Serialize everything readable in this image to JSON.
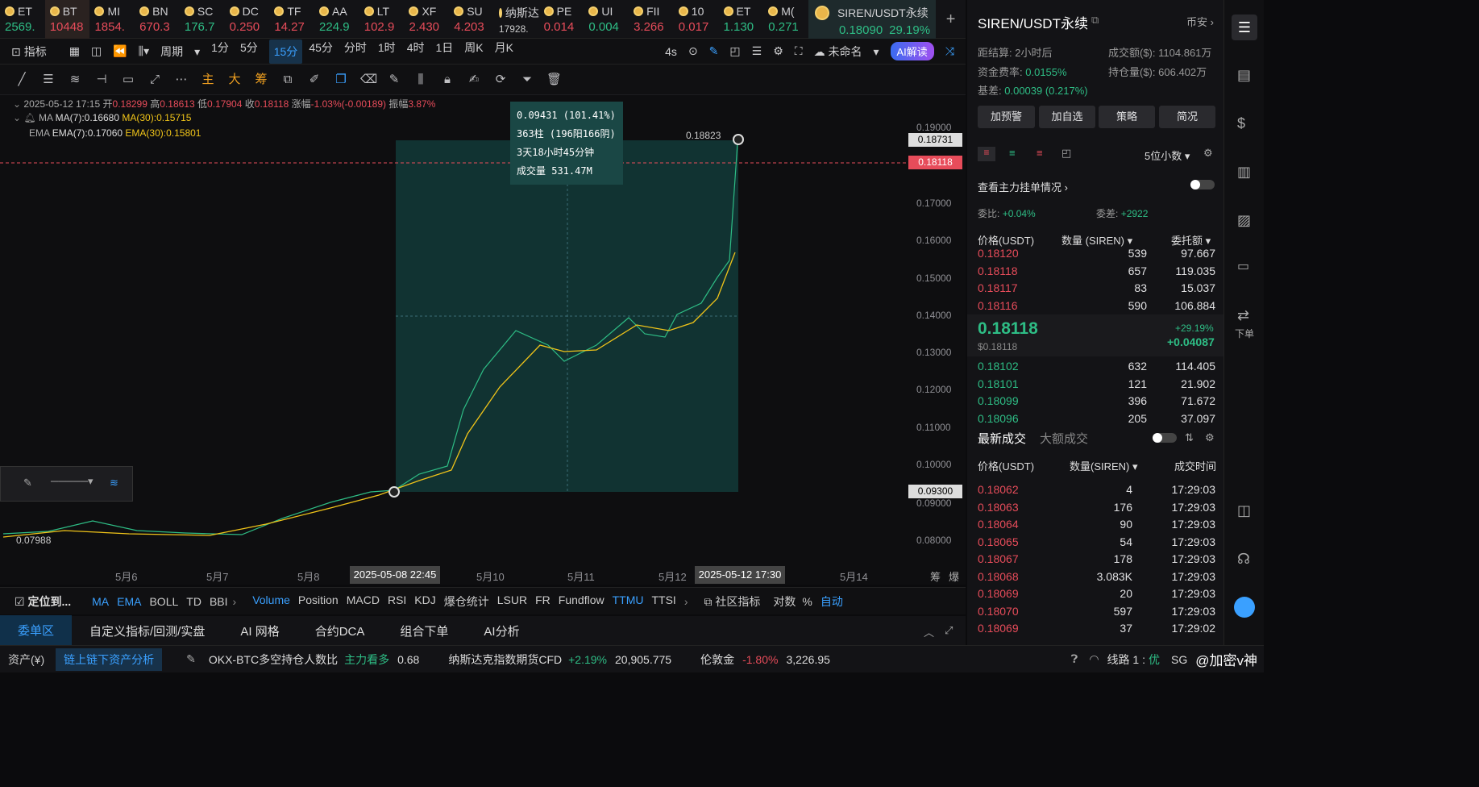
{
  "tickers": [
    {
      "name": "ET",
      "price": "2569.",
      "dir": "up"
    },
    {
      "name": "BT",
      "price": "10448",
      "dir": "dn"
    },
    {
      "name": "MI",
      "price": "1854.",
      "dir": "dn"
    },
    {
      "name": "BN",
      "price": "670.3",
      "dir": "dn"
    },
    {
      "name": "SC",
      "price": "176.7",
      "dir": "up"
    },
    {
      "name": "DC",
      "price": "0.250",
      "dir": "dn"
    },
    {
      "name": "TF",
      "price": "14.27",
      "dir": "dn"
    },
    {
      "name": "AA",
      "price": "224.9",
      "dir": "up"
    },
    {
      "name": "LT",
      "price": "102.9",
      "dir": "dn"
    },
    {
      "name": "XF",
      "price": "2.430",
      "dir": "dn"
    },
    {
      "name": "SU",
      "price": "4.203",
      "dir": "dn"
    },
    {
      "name": "纳斯达",
      "price": "17928.",
      "dir": "neutral"
    },
    {
      "name": "PE",
      "price": "0.014",
      "dir": "dn"
    },
    {
      "name": "UI",
      "price": "0.004",
      "dir": "up"
    },
    {
      "name": "FII",
      "price": "3.266",
      "dir": "dn"
    },
    {
      "name": "10",
      "price": "0.017",
      "dir": "dn"
    },
    {
      "name": "ET",
      "price": "1.130",
      "dir": "up"
    },
    {
      "name": "M(",
      "price": "0.271",
      "dir": "up"
    }
  ],
  "active_ticker": {
    "name": "SIREN/USDT永续",
    "price": "0.18090",
    "change": "29.19%"
  },
  "toolbar": {
    "indicator": "指标",
    "period": "周期",
    "intervals": [
      "1分",
      "5分",
      "15分",
      "45分",
      "分时",
      "1时",
      "4时",
      "1日",
      "周K",
      "月K"
    ],
    "selected_interval": "15分",
    "refresh": "4s",
    "layout_name": "未命名",
    "ai_label": "AI解读"
  },
  "drawing_tools": {
    "main": "主",
    "big": "大",
    "chips": "筹"
  },
  "ohlc": {
    "date": "2025-05-12 17:15",
    "open_label": "开",
    "open": "0.18299",
    "high_label": "高",
    "high": "0.18613",
    "low_label": "低",
    "low": "0.17904",
    "close_label": "收",
    "close": "0.18118",
    "chg_label": "涨幅",
    "chg": "-1.03%(-0.00189)",
    "amp_label": "振幅",
    "amp": "3.87%"
  },
  "ma_legend": {
    "name": "MA",
    "ma7": "MA(7):0.16680",
    "ma30": "MA(30):0.15715"
  },
  "ema_legend": {
    "name": "EMA",
    "ema7": "EMA(7):0.17060",
    "ema30": "EMA(30):0.15801"
  },
  "measure_box": {
    "line1": "0.09431 (101.41%)",
    "line2": "363柱 (196阳166阴)",
    "line3": "3天18小时45分钟",
    "line4": "成交量 531.47M"
  },
  "high_mark": "0.18823",
  "low_mark": "0.07988",
  "y_axis": [
    "0.19000",
    "0.17000",
    "0.16000",
    "0.15000",
    "0.14000",
    "0.13000",
    "0.12000",
    "0.11000",
    "0.10000",
    "0.09000",
    "0.08000"
  ],
  "y_tags": {
    "top": "0.18731",
    "current": "0.18118",
    "bottom": "0.09300"
  },
  "x_axis": [
    "5月6",
    "5月7",
    "5月8",
    "5月10",
    "5月11",
    "5月12",
    "5月14"
  ],
  "x_tags": {
    "start": "2025-05-08 22:45",
    "end": "2025-05-12 17:30"
  },
  "x_extra": [
    "筹",
    "爆"
  ],
  "indicator_bar": {
    "locate": "定位到...",
    "main": [
      "MA",
      "EMA",
      "BOLL",
      "TD",
      "BBI"
    ],
    "sub": [
      "Volume",
      "Position",
      "MACD",
      "RSI",
      "KDJ",
      "爆仓统计",
      "LSUR",
      "FR",
      "Fundflow",
      "TTMU",
      "TTSI"
    ],
    "community": "社区指标",
    "ratio": "对数",
    "pct": "%",
    "auto": "自动"
  },
  "bottom_tabs": [
    "委单区",
    "自定义指标/回测/实盘",
    "AI 网格",
    "合约DCA",
    "组合下单",
    "AI分析"
  ],
  "status_bar": {
    "assets": "资产(¥)",
    "chain": "链上链下资产分析",
    "ratio_label": "OKX-BTC多空持仓人数比",
    "ratio_hint": "主力看多",
    "ratio_val": "0.68",
    "ndx_label": "纳斯达克指数期货CFD",
    "ndx_chg": "+2.19%",
    "ndx_val": "20,905.775",
    "gold_label": "伦敦金",
    "gold_chg": "-1.80%",
    "gold_val": "3,226.95",
    "line": "线路 1 :",
    "line_q": "优",
    "sg": "SG",
    "watermark": "@加密v神"
  },
  "right_panel": {
    "title": "SIREN/USDT永续",
    "exchange": "币安",
    "settle_label": "距结算:",
    "settle": "2小时后",
    "vol_label": "成交额($):",
    "vol": "1104.861万",
    "fund_label": "资金费率:",
    "fund": "0.0155%",
    "oi_label": "持仓量($):",
    "oi": "606.402万",
    "basis_label": "基差:",
    "basis": "0.00039 (0.217%)",
    "buttons": [
      "加预警",
      "加自选",
      "策略",
      "简况"
    ],
    "decimals": "5位小数",
    "whale_label": "查看主力挂单情况",
    "ratio_label": "委比:",
    "ratio": "+0.04%",
    "diff_label": "委差:",
    "diff": "+2922",
    "ob_headers": [
      "价格(USDT)",
      "数量 (SIREN)",
      "委托额"
    ],
    "asks": [
      {
        "p": "0.18120",
        "q": "539",
        "t": "97.667"
      },
      {
        "p": "0.18118",
        "q": "657",
        "t": "119.035"
      },
      {
        "p": "0.18117",
        "q": "83",
        "t": "15.037"
      },
      {
        "p": "0.18116",
        "q": "590",
        "t": "106.884"
      }
    ],
    "last_price": "0.18118",
    "last_usd": "$0.18118",
    "last_pct": "+29.19%",
    "last_chg": "+0.04087",
    "bids": [
      {
        "p": "0.18102",
        "q": "632",
        "t": "114.405"
      },
      {
        "p": "0.18101",
        "q": "121",
        "t": "21.902"
      },
      {
        "p": "0.18099",
        "q": "396",
        "t": "71.672"
      },
      {
        "p": "0.18096",
        "q": "205",
        "t": "37.097"
      }
    ],
    "trade_tabs": [
      "最新成交",
      "大额成交"
    ],
    "trade_headers": [
      "价格(USDT)",
      "数量(SIREN)",
      "成交时间"
    ],
    "trades": [
      {
        "p": "0.18062",
        "q": "4",
        "t": "17:29:03"
      },
      {
        "p": "0.18063",
        "q": "176",
        "t": "17:29:03"
      },
      {
        "p": "0.18064",
        "q": "90",
        "t": "17:29:03"
      },
      {
        "p": "0.18065",
        "q": "54",
        "t": "17:29:03"
      },
      {
        "p": "0.18067",
        "q": "178",
        "t": "17:29:03"
      },
      {
        "p": "0.18068",
        "q": "3.083K",
        "t": "17:29:03"
      },
      {
        "p": "0.18069",
        "q": "20",
        "t": "17:29:03"
      },
      {
        "p": "0.18070",
        "q": "597",
        "t": "17:29:03"
      },
      {
        "p": "0.18069",
        "q": "37",
        "t": "17:29:02"
      }
    ]
  },
  "right_bar": {
    "order_label": "下单"
  },
  "colors": {
    "up": "#2ebd85",
    "down": "#e74c5a",
    "accent": "#3aa0ff",
    "ma30": "#f0c419",
    "measure": "#1d4a48"
  }
}
